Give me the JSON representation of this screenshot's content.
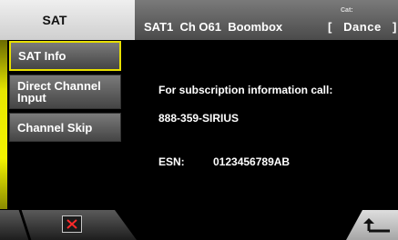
{
  "header": {
    "source_tab": "SAT",
    "channel_info": "SAT1  Ch O61  Boombox",
    "category_label": "Cat:",
    "category_value": "[   Dance   ]"
  },
  "menu": {
    "items": [
      {
        "label": "SAT Info",
        "selected": true
      },
      {
        "label": "Direct Channel Input"
      },
      {
        "label": "Channel Skip"
      }
    ]
  },
  "content": {
    "subscription_text": "For subscription information call:",
    "phone": "888-359-SIRIUS",
    "esn_label": "ESN:",
    "esn_value": "0123456789AB"
  },
  "colors": {
    "selection": "#e8e000",
    "close_icon": "#ff2a2a"
  },
  "icons": {
    "close": "close-x-icon",
    "back": "back-arrow-icon"
  }
}
